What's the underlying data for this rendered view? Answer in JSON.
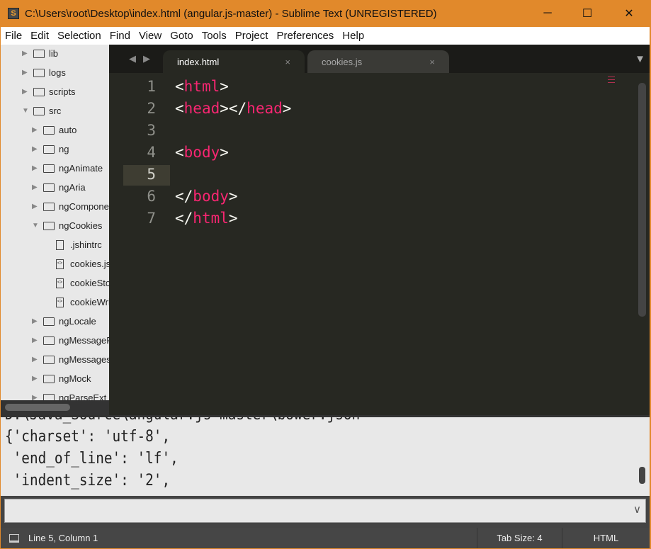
{
  "window": {
    "title": "C:\\Users\\root\\Desktop\\index.html (angular.js-master) - Sublime Text (UNREGISTERED)",
    "minimize": "─",
    "maximize": "☐",
    "close": "✕"
  },
  "menu": [
    "File",
    "Edit",
    "Selection",
    "Find",
    "View",
    "Goto",
    "Tools",
    "Project",
    "Preferences",
    "Help"
  ],
  "sidebar": {
    "items": [
      {
        "label": "lib",
        "type": "folder",
        "level": 1,
        "expanded": false
      },
      {
        "label": "logs",
        "type": "folder",
        "level": 1,
        "expanded": false
      },
      {
        "label": "scripts",
        "type": "folder",
        "level": 1,
        "expanded": false
      },
      {
        "label": "src",
        "type": "folder",
        "level": 1,
        "expanded": true
      },
      {
        "label": "auto",
        "type": "folder",
        "level": 2,
        "expanded": false
      },
      {
        "label": "ng",
        "type": "folder",
        "level": 2,
        "expanded": false
      },
      {
        "label": "ngAnimate",
        "type": "folder",
        "level": 2,
        "expanded": false
      },
      {
        "label": "ngAria",
        "type": "folder",
        "level": 2,
        "expanded": false
      },
      {
        "label": "ngComponentRouter",
        "type": "folder",
        "level": 2,
        "expanded": false
      },
      {
        "label": "ngCookies",
        "type": "folder",
        "level": 2,
        "expanded": true
      },
      {
        "label": ".jshintrc",
        "type": "file",
        "level": 3
      },
      {
        "label": "cookies.js",
        "type": "code",
        "level": 3
      },
      {
        "label": "cookieStore.js",
        "type": "code",
        "level": 3
      },
      {
        "label": "cookieWriter.js",
        "type": "code",
        "level": 3
      },
      {
        "label": "ngLocale",
        "type": "folder",
        "level": 2,
        "expanded": false
      },
      {
        "label": "ngMessageFormat",
        "type": "folder",
        "level": 2,
        "expanded": false
      },
      {
        "label": "ngMessages",
        "type": "folder",
        "level": 2,
        "expanded": false
      },
      {
        "label": "ngMock",
        "type": "folder",
        "level": 2,
        "expanded": false
      },
      {
        "label": "ngParseExt",
        "type": "folder",
        "level": 2,
        "expanded": false
      }
    ]
  },
  "tabs": [
    {
      "label": "index.html",
      "active": true,
      "close": "×"
    },
    {
      "label": "cookies.js",
      "active": false,
      "close": "×"
    }
  ],
  "editor": {
    "current_line": 5,
    "lines": [
      [
        [
          "p",
          "<"
        ],
        [
          "t",
          "html"
        ],
        [
          "p",
          ">"
        ]
      ],
      [
        [
          "p",
          "<"
        ],
        [
          "t",
          "head"
        ],
        [
          "p",
          "></"
        ],
        [
          "t",
          "head"
        ],
        [
          "p",
          ">"
        ]
      ],
      [],
      [
        [
          "p",
          "<"
        ],
        [
          "t",
          "body"
        ],
        [
          "p",
          ">"
        ]
      ],
      [],
      [
        [
          "p",
          "</"
        ],
        [
          "t",
          "body"
        ],
        [
          "p",
          ">"
        ]
      ],
      [
        [
          "p",
          "</"
        ],
        [
          "t",
          "html"
        ],
        [
          "p",
          ">"
        ]
      ]
    ]
  },
  "console": {
    "lines": [
      "D:\\Java_Source\\angular.js-master\\bower.json",
      "{'charset': 'utf-8',",
      " 'end_of_line': 'lf',",
      " 'indent_size': '2',"
    ]
  },
  "input": {
    "value": "",
    "dropdown": "∨"
  },
  "status": {
    "position": "Line 5, Column 1",
    "tab_size": "Tab Size: 4",
    "syntax": "HTML"
  },
  "colors": {
    "accent": "#e1892b",
    "tag": "#f92672",
    "editor_bg": "#272822"
  }
}
